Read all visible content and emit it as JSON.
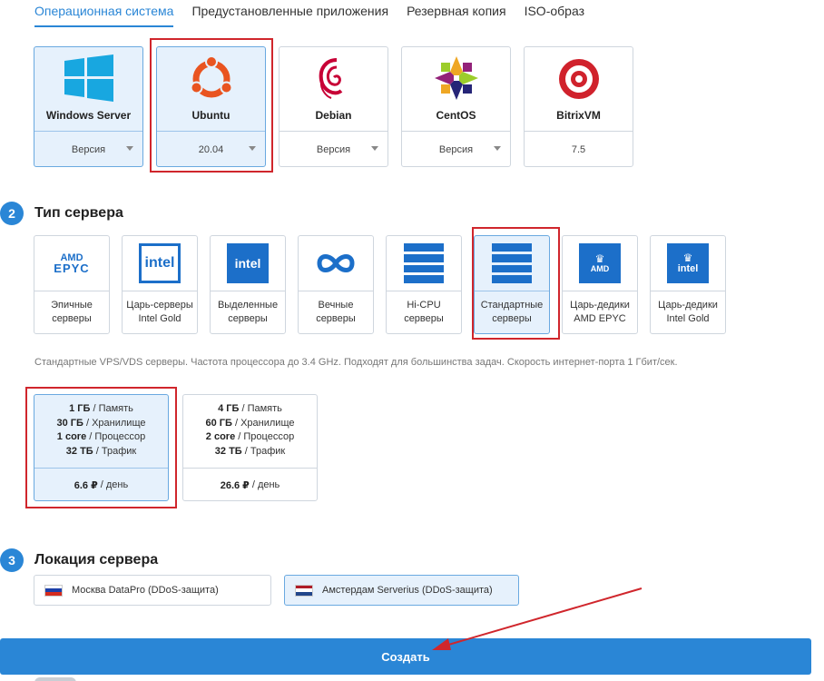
{
  "tabs": [
    {
      "label": "Операционная система",
      "active": true
    },
    {
      "label": "Предустановленные приложения",
      "active": false
    },
    {
      "label": "Резервная копия",
      "active": false
    },
    {
      "label": "ISO-образ",
      "active": false
    }
  ],
  "os": [
    {
      "name": "Windows Server",
      "version": "Версия",
      "icon": "windows-logo-icon",
      "dropdown": true,
      "selected": true
    },
    {
      "name": "Ubuntu",
      "version": "20.04",
      "icon": "ubuntu-logo-icon",
      "dropdown": true,
      "selected": true
    },
    {
      "name": "Debian",
      "version": "Версия",
      "icon": "debian-logo-icon",
      "dropdown": true,
      "selected": false
    },
    {
      "name": "CentOS",
      "version": "Версия",
      "icon": "centos-logo-icon",
      "dropdown": true,
      "selected": false
    },
    {
      "name": "BitrixVM",
      "version": "7.5",
      "icon": "bitrix-logo-icon",
      "dropdown": false,
      "selected": false
    }
  ],
  "section2": {
    "number": "2",
    "title": "Тип сервера"
  },
  "server_types": [
    {
      "line1": "Эпичные",
      "line2": "серверы",
      "icon_text": "AMD EPYC",
      "icon": "amd-epyc-icon",
      "selected": false
    },
    {
      "line1": "Царь-серверы",
      "line2": "Intel Gold",
      "icon_text": "intel",
      "icon": "intel-gold-icon",
      "selected": false
    },
    {
      "line1": "Выделенные",
      "line2": "серверы",
      "icon_text": "intel",
      "icon": "intel-dedicated-icon",
      "selected": false
    },
    {
      "line1": "Вечные",
      "line2": "серверы",
      "icon_text": "∞",
      "icon": "infinity-icon",
      "selected": false
    },
    {
      "line1": "Hi-CPU",
      "line2": "серверы",
      "icon_text": "",
      "icon": "server-rack-icon",
      "selected": false
    },
    {
      "line1": "Стандартные",
      "line2": "серверы",
      "icon_text": "",
      "icon": "server-rack-icon",
      "selected": true
    },
    {
      "line1": "Царь-дедики",
      "line2": "AMD EPYC",
      "icon_text": "AMD",
      "icon": "crown-amd-icon",
      "selected": false
    },
    {
      "line1": "Царь-дедики",
      "line2": "Intel Gold",
      "icon_text": "intel",
      "icon": "crown-intel-icon",
      "selected": false
    }
  ],
  "type_description": "Стандартные VPS/VDS серверы. Частота процессора до 3.4 GHz. Подходят для большинства задач. Скорость интернет-порта 1 Гбит/сек.",
  "plans": [
    {
      "lines": [
        {
          "value": "1 ГБ",
          "label": " / Память"
        },
        {
          "value": "30 ГБ",
          "label": " / Хранилище"
        },
        {
          "value": "1 core",
          "label": " / Процессор"
        },
        {
          "value": "32 ТБ",
          "label": " / Трафик"
        }
      ],
      "price": "6.6 ₽",
      "period": "/ день",
      "selected": true
    },
    {
      "lines": [
        {
          "value": "4 ГБ",
          "label": " / Память"
        },
        {
          "value": "60 ГБ",
          "label": " / Хранилище"
        },
        {
          "value": "2 core",
          "label": " / Процессор"
        },
        {
          "value": "32 ТБ",
          "label": " / Трафик"
        }
      ],
      "price": "26.6 ₽",
      "period": "/ день",
      "selected": false
    }
  ],
  "section3": {
    "number": "3",
    "title": "Локация сервера"
  },
  "locations": [
    {
      "label": "Москва DataPro (DDoS-защита)",
      "flag": [
        "#ffffff",
        "#1c3fa8",
        "#d52b1e"
      ],
      "selected": false
    },
    {
      "label": "Амстердам Serverius (DDoS-защита)",
      "flag": [
        "#ae1c28",
        "#ffffff",
        "#21468b"
      ],
      "selected": true
    }
  ],
  "create_button": "Создать",
  "colors": {
    "accent": "#2a86d6",
    "highlight": "#d0262c",
    "selected_bg": "#e6f1fc"
  }
}
